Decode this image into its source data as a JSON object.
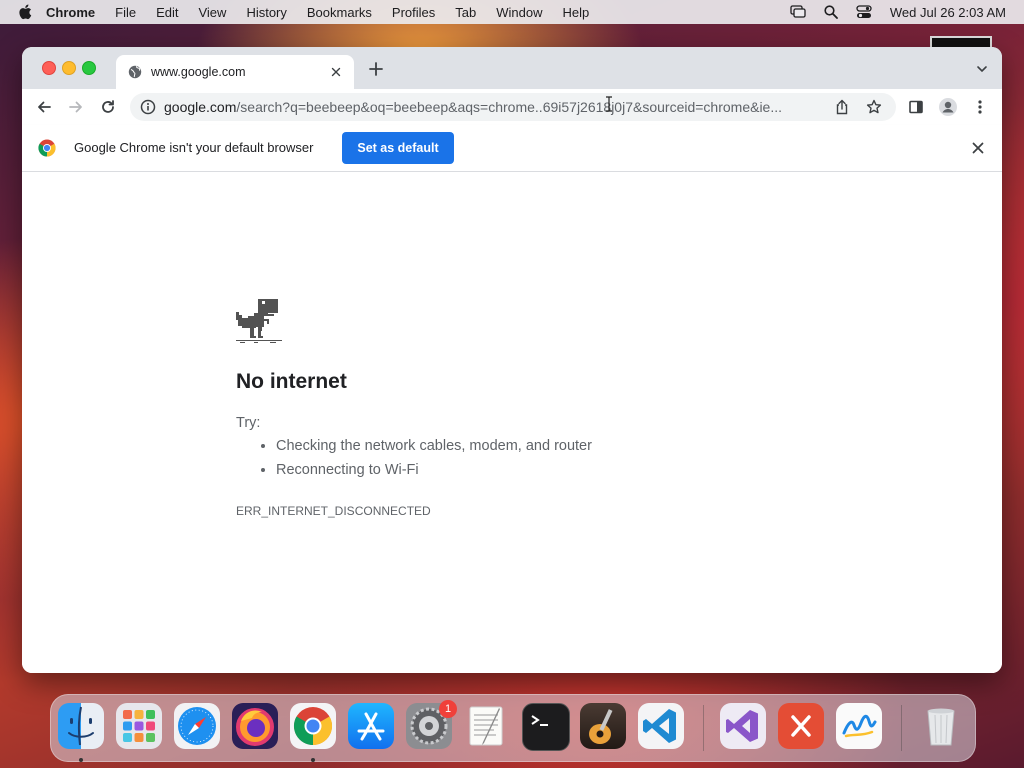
{
  "menubar": {
    "app_name": "Chrome",
    "items": [
      "File",
      "Edit",
      "View",
      "History",
      "Bookmarks",
      "Profiles",
      "Tab",
      "Window",
      "Help"
    ],
    "clock": "Wed Jul 26  2:03 AM",
    "status_icons": [
      "screen-mirroring-icon",
      "spotlight-search-icon",
      "control-center-icon"
    ]
  },
  "browser": {
    "tab": {
      "title": "www.google.com",
      "icon": "globe-icon"
    },
    "omnibox": {
      "host": "google.com",
      "path": "/search?q=beebeep&oq=beebeep&aqs=chrome..69i57j2618j0j7&sourceid=chrome&ie..."
    },
    "infobar": {
      "message": "Google Chrome isn't your default browser",
      "button_label": "Set as default"
    },
    "error_page": {
      "heading": "No internet",
      "try_label": "Try:",
      "suggestions": [
        "Checking the network cables, modem, and router",
        "Reconnecting to Wi-Fi"
      ],
      "error_code": "ERR_INTERNET_DISCONNECTED"
    }
  },
  "dock": {
    "apps": [
      {
        "name": "Finder",
        "icon": "finder-icon",
        "running": true
      },
      {
        "name": "Launchpad",
        "icon": "launchpad-icon",
        "running": false
      },
      {
        "name": "Safari",
        "icon": "safari-icon",
        "running": false
      },
      {
        "name": "Firefox",
        "icon": "firefox-icon",
        "running": false
      },
      {
        "name": "Google Chrome",
        "icon": "chrome-icon",
        "running": true
      },
      {
        "name": "App Store",
        "icon": "app-store-icon",
        "running": false
      },
      {
        "name": "System Settings",
        "icon": "system-settings-icon",
        "running": false,
        "badge": "1"
      },
      {
        "name": "TextEdit",
        "icon": "textedit-icon",
        "running": false
      },
      {
        "name": "Terminal",
        "icon": "terminal-icon",
        "running": false
      },
      {
        "name": "GarageBand",
        "icon": "garageband-icon",
        "running": false
      },
      {
        "name": "Visual Studio Code",
        "icon": "vscode-icon",
        "running": false
      },
      {
        "name": "Visual Studio",
        "icon": "visual-studio-icon",
        "running": false
      },
      {
        "name": "Remote Desktop",
        "icon": "remote-desktop-icon",
        "running": false
      },
      {
        "name": "Freeform",
        "icon": "freeform-icon",
        "running": false
      },
      {
        "name": "Trash",
        "icon": "trash-icon",
        "running": false
      }
    ]
  }
}
